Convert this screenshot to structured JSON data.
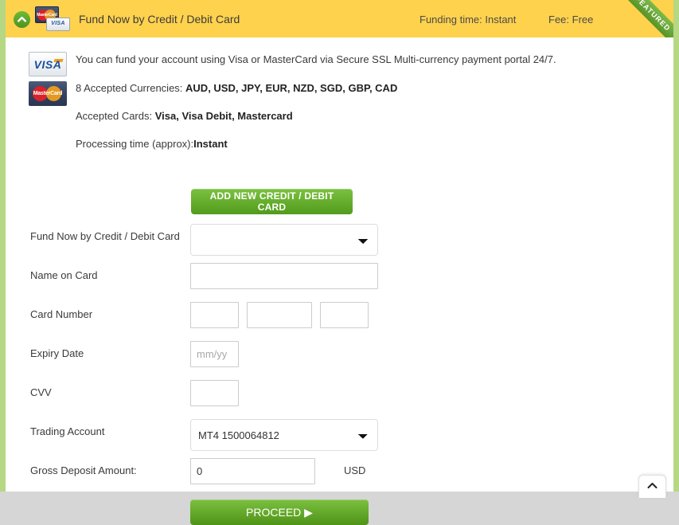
{
  "header": {
    "title": "Fund Now by Credit / Debit Card",
    "funding_time": "Funding time: Instant",
    "fee": "Fee: Free",
    "ribbon": "FEATURED",
    "collapse_icon": "chevron-up-icon",
    "badge_mastercard_text": "MasterCard",
    "badge_visa_text": "VISA",
    "accent_yellow": "#FFD24D",
    "accent_green": "#6AA83C"
  },
  "logos": {
    "visa": "VISA",
    "mastercard": "MasterCard"
  },
  "info": {
    "line1": "You can fund your account using Visa or MasterCard via Secure SSL Multi-currency payment portal 24/7.",
    "currencies_label": "8 Accepted Currencies: ",
    "currencies_value": "AUD, USD, JPY, EUR, NZD, SGD, GBP, CAD",
    "cards_label": "Accepted Cards: ",
    "cards_value": "Visa, Visa Debit, Mastercard",
    "processing_label": "Processing time (approx):",
    "processing_value": "Instant"
  },
  "buttons": {
    "add_card": "ADD NEW CREDIT / DEBIT CARD",
    "proceed": "PROCEED ▶"
  },
  "form": {
    "card_select": {
      "label": "Fund Now by Credit / Debit Card",
      "value": "",
      "options": [
        ""
      ]
    },
    "name_on_card": {
      "label": "Name on Card",
      "value": "",
      "placeholder": ""
    },
    "card_number": {
      "label": "Card Number",
      "part1_value": "",
      "part2_value": "",
      "part3_value": ""
    },
    "expiry": {
      "label": "Expiry Date",
      "value": "",
      "placeholder": "mm/yy"
    },
    "cvv": {
      "label": "CVV",
      "value": "",
      "placeholder": ""
    },
    "trading_account": {
      "label": "Trading Account",
      "value": "MT4 1500064812",
      "options": [
        "MT4 1500064812"
      ]
    },
    "gross_deposit": {
      "label": "Gross Deposit Amount:",
      "value": "0",
      "currency": "USD"
    }
  },
  "scroll_top": {
    "icon": "chevron-up-icon"
  }
}
